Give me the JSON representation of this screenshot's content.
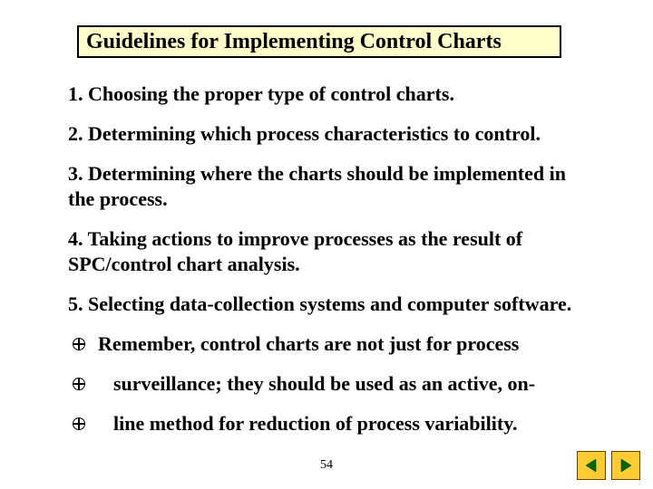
{
  "title": "Guidelines for Implementing Control Charts",
  "items": {
    "i1": "1. Choosing the proper type of control charts.",
    "i2": "2. Determining which process characteristics to control.",
    "i3": "3. Determining where the charts should be implemented in the process.",
    "i4": "4. Taking actions to improve processes as the result of SPC/control chart analysis.",
    "i5": "5. Selecting data-collection systems and computer software."
  },
  "bullets": {
    "b1": "Remember, control charts are not just for process",
    "b2": "surveillance; they should be used as an active, on-",
    "b3": "line method for reduction of process variability."
  },
  "page_number": "54"
}
